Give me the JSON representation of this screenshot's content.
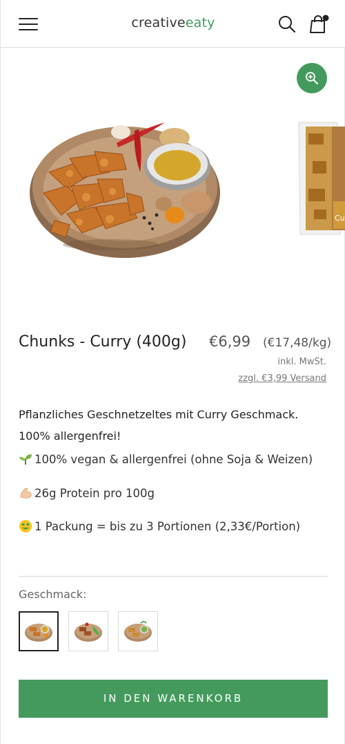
{
  "header": {
    "logo_part1": "creative",
    "logo_part2": "eaty",
    "icons": [
      "menu-icon",
      "search-icon",
      "shopping-bag-icon"
    ]
  },
  "gallery": {
    "main_image": "curry-chunks-on-wooden-plate",
    "next_image": "curry-chunks-package",
    "next_image_text": "Cu",
    "zoom_icon": "zoom-in-icon"
  },
  "product": {
    "title": "Chunks - Curry (400g)",
    "price": "€6,99",
    "unit_price": "(€17,48/kg)",
    "tax_note": "inkl. MwSt.",
    "shipping": "zzgl. €3,99 Versand",
    "subtitle_line1": "Pflanzliches Geschnetzeltes mit Curry Geschmack.",
    "subtitle_line2": "100% allergenfrei!",
    "features": [
      {
        "icon": "seedling-emoji",
        "text": "100% vegan & allergenfrei (ohne Soja & Weizen)"
      },
      {
        "icon": "flexed-biceps-emoji",
        "text": "26g Protein pro 100g"
      },
      {
        "icon": "money-mouth-face-emoji",
        "text": "1 Packung = bis zu 3 Portionen (2,33€/Portion)"
      }
    ]
  },
  "variants": {
    "label": "Geschmack:",
    "selected_index": 0,
    "swatches": [
      "curry-variant",
      "herb-variant",
      "green-variant"
    ]
  },
  "cart": {
    "button_label": "IN DEN WARENKORB"
  },
  "colors": {
    "accent": "#449a5d",
    "text": "#222222"
  }
}
